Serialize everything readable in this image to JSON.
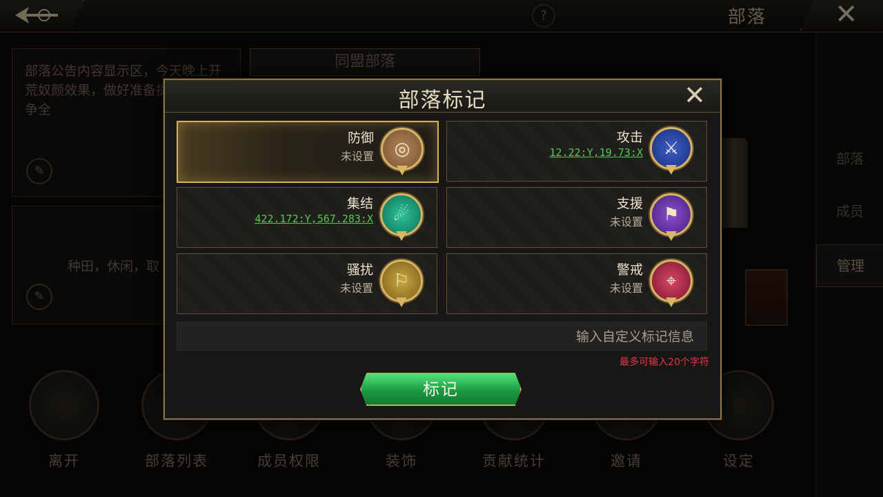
{
  "topbar": {
    "title": "部落",
    "help_glyph": "?",
    "close_glyph": "✕"
  },
  "background": {
    "notice_text": "部落公告内容显示区，今天晚上开荒奴颜效果，做好准备提前上线，争全",
    "alliance_tab": "同盟部落",
    "desc_text": "种田，休闲，取",
    "edit_glyph": "✎",
    "side_nav": [
      "部落",
      "成员",
      "管理"
    ],
    "actions": [
      "离开",
      "部落列表",
      "成员权限",
      "装饰",
      "贡献统计",
      "邀请",
      "设定"
    ]
  },
  "modal": {
    "title": "部落标记",
    "close_glyph": "✕",
    "marks": [
      {
        "name": "防御",
        "status": "未设置",
        "icon": "shield-icon",
        "glyph": "◎"
      },
      {
        "name": "攻击",
        "status": "12.22:Y,19.73:X",
        "icon": "crossed-swords-icon",
        "glyph": "⚔"
      },
      {
        "name": "集结",
        "status": "422.172:Y,567.283:X",
        "icon": "horn-icon",
        "glyph": "☄"
      },
      {
        "name": "支援",
        "status": "未设置",
        "icon": "flag-fist-icon",
        "glyph": "⚑"
      },
      {
        "name": "骚扰",
        "status": "未设置",
        "icon": "raid-flag-icon",
        "glyph": "⚐"
      },
      {
        "name": "警戒",
        "status": "未设置",
        "icon": "spyglass-icon",
        "glyph": "⌖"
      }
    ],
    "input_placeholder": "输入自定义标记信息",
    "limit_hint": "最多可输入20个字符",
    "confirm_label": "标记"
  }
}
